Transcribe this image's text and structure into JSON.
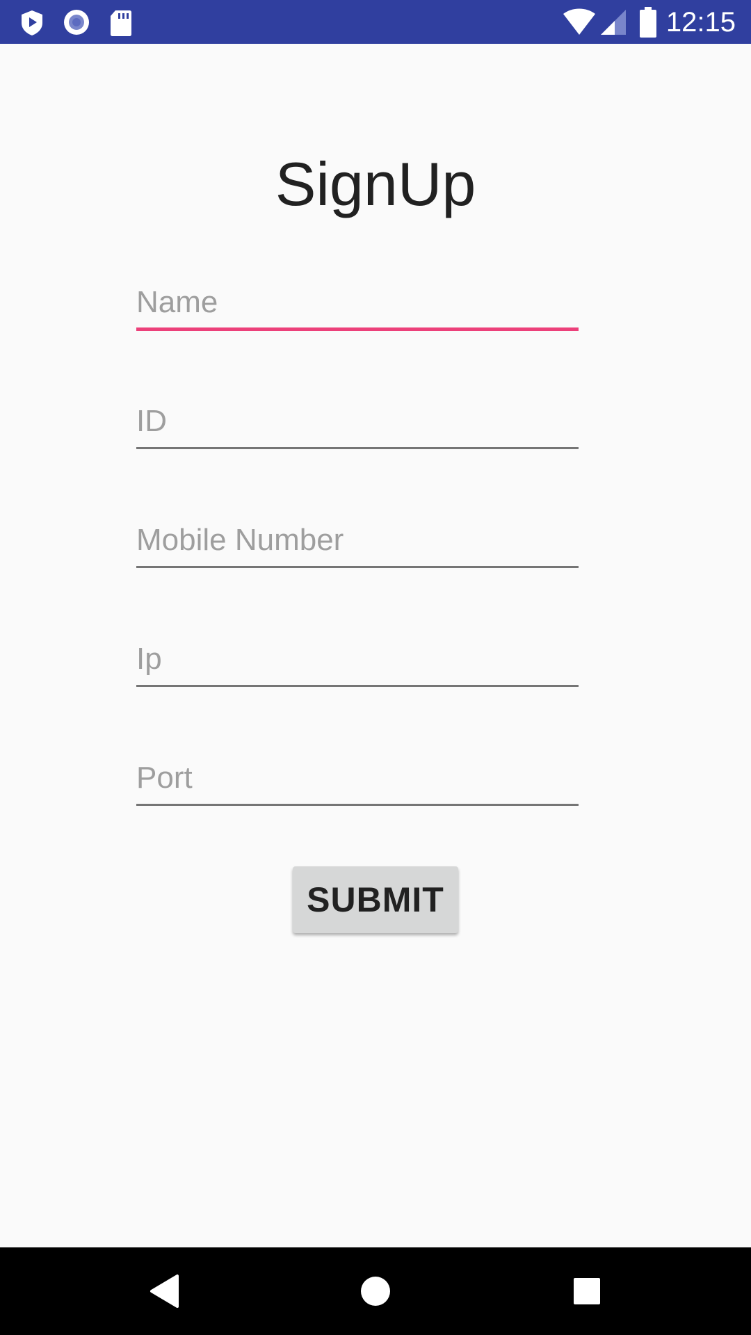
{
  "status_bar": {
    "time": "12:15",
    "background": "#303f9f",
    "left_icons": [
      "shield-play-icon",
      "record-icon",
      "sd-card-icon"
    ],
    "right_icons": [
      "wifi-icon",
      "cell-signal-icon",
      "battery-icon"
    ]
  },
  "page": {
    "title": "SignUp"
  },
  "form": {
    "fields": [
      {
        "placeholder": "Name",
        "value": "",
        "focused": true
      },
      {
        "placeholder": "ID",
        "value": ""
      },
      {
        "placeholder": "Mobile Number",
        "value": ""
      },
      {
        "placeholder": "Ip",
        "value": ""
      },
      {
        "placeholder": "Port",
        "value": ""
      }
    ],
    "submit_label": "SUBMIT",
    "focus_color": "#ec407a",
    "underline_color": "#757575"
  },
  "nav_bar": {
    "buttons": [
      "back-icon",
      "home-icon",
      "recents-icon"
    ]
  }
}
